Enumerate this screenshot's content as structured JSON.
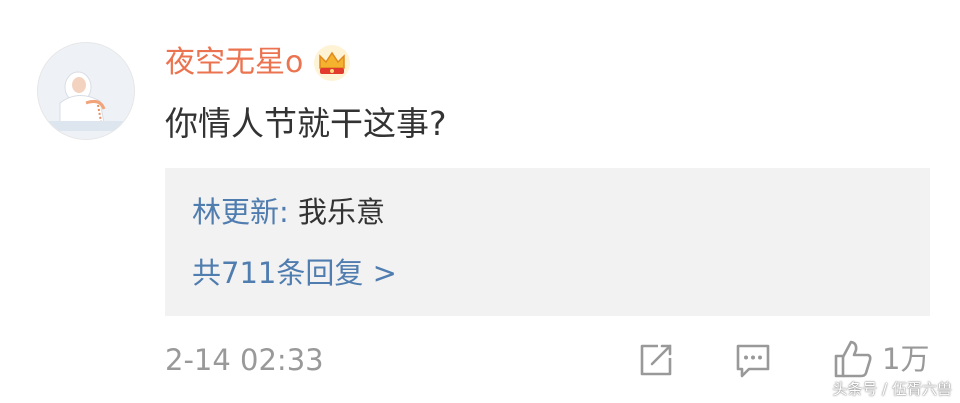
{
  "comment": {
    "username": "夜空无星o",
    "badge_icon": "crown-badge-icon",
    "text": "你情人节就干这事?",
    "reply": {
      "author": "林更新",
      "separator": ": ",
      "text": "我乐意",
      "count_label": "共711条回复 >"
    },
    "timestamp": "2-14 02:33",
    "actions": {
      "share_icon": "share-icon",
      "comment_icon": "comment-icon",
      "like_icon": "thumbs-up-icon",
      "like_count": "1万"
    }
  },
  "watermark": "头条号 / 伍胥六兽",
  "colors": {
    "username": "#eb7350",
    "link": "#507daf",
    "text": "#333333",
    "meta": "#999999",
    "reply_bg": "#f2f2f2"
  }
}
